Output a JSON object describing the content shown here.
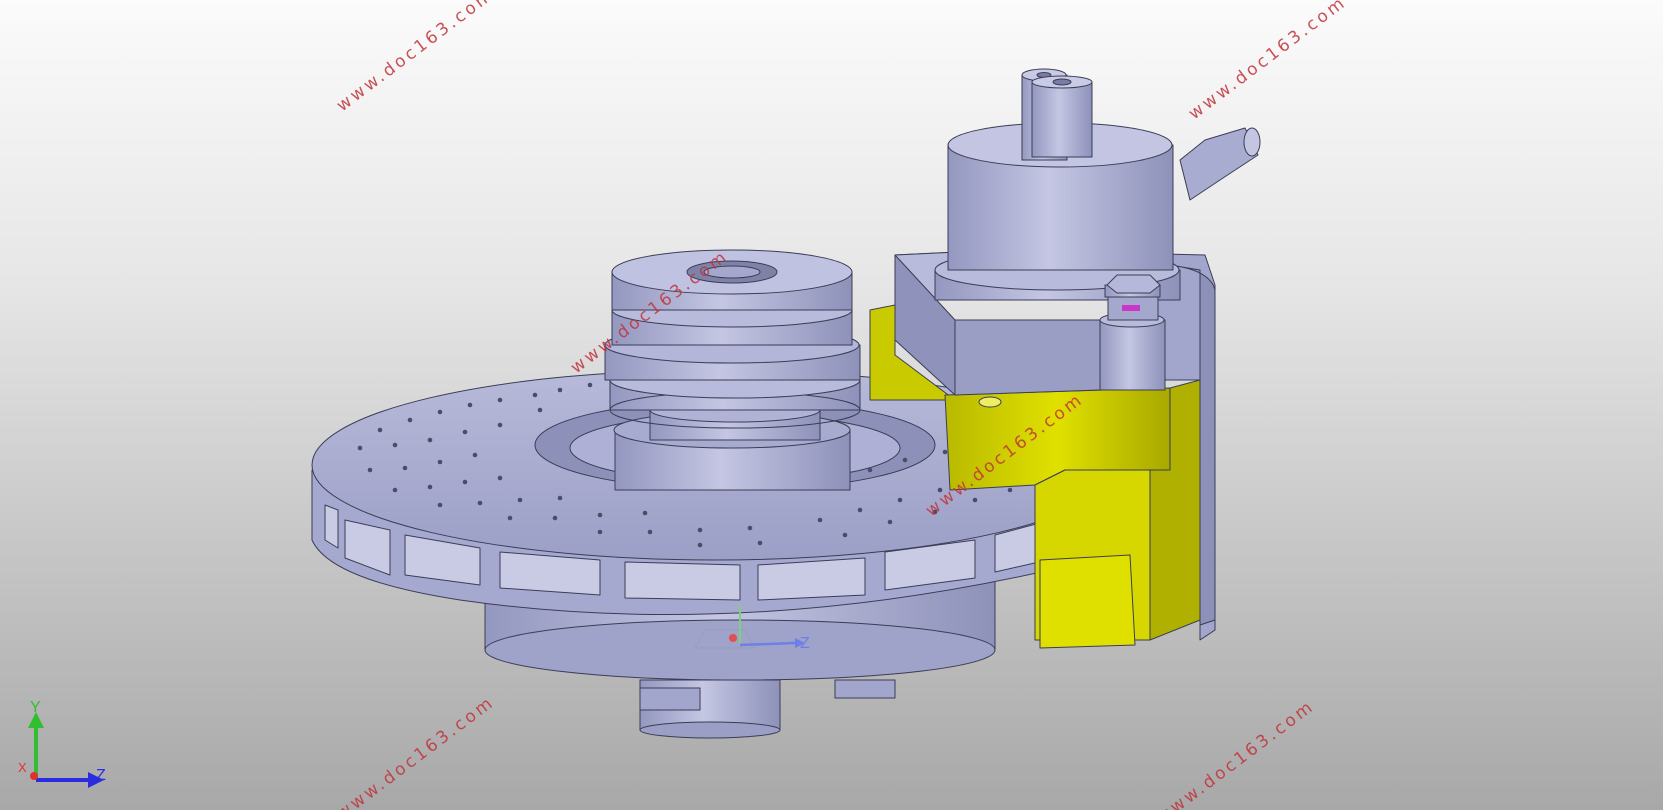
{
  "viewport": {
    "background_top": "#fbfbfb",
    "background_bottom": "#a8a8a8"
  },
  "watermark": "www.doc163.com",
  "model": {
    "body_color": "#b0b3d8",
    "bracket_color": "#d8d800",
    "edge_color": "#3a3d55"
  },
  "triad": {
    "y": "Y",
    "z": "Z",
    "x": "X"
  },
  "local_axis": {
    "z": "Z"
  }
}
